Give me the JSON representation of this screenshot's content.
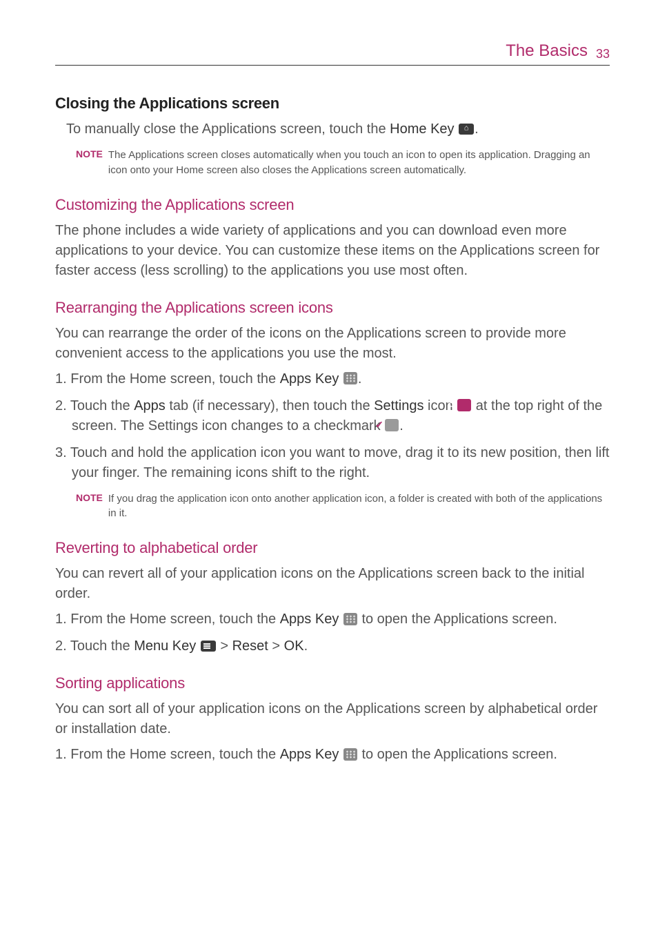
{
  "header": {
    "section": "The Basics",
    "page": "33"
  },
  "closing": {
    "heading": "Closing the Applications screen",
    "body_part1": "To manually close the Applications screen, touch the ",
    "body_bold": "Home Key",
    "body_part2": ".",
    "note_label": "NOTE",
    "note_text": "The Applications screen closes automatically when you touch an icon to open its application. Dragging an icon onto your Home screen also closes the Applications screen automatically."
  },
  "customizing": {
    "heading": "Customizing the Applications screen",
    "body": "The phone includes a wide variety of applications and you can download even more applications to your device. You can customize these items on the Applications screen for faster access (less scrolling) to the applications you use most often."
  },
  "rearranging": {
    "heading": "Rearranging the Applications screen icons",
    "body": "You can rearrange the order of the icons on the Applications screen to provide more convenient access to the applications you use the most.",
    "step1_a": "From the Home screen, touch the ",
    "step1_b": "Apps Key",
    "step1_c": ".",
    "step2_a": "Touch the ",
    "step2_b": "Apps",
    "step2_c": " tab (if necessary), then touch the ",
    "step2_d": "Settings",
    "step2_e": " icon ",
    "step2_f": " at the top right of the screen. The Settings icon changes to a checkmark ",
    "step2_g": ".",
    "step3": "Touch and hold the application icon you want to move, drag it to its new position, then lift your finger. The remaining icons shift to the right.",
    "note_label": "NOTE",
    "note_text": "If you drag the application icon onto another application icon, a folder is created with both of the applications in it."
  },
  "reverting": {
    "heading": "Reverting to alphabetical order",
    "body": "You can revert all of your application icons on the Applications screen back to the initial order.",
    "step1_a": "From the Home screen, touch the ",
    "step1_b": "Apps Key",
    "step1_c": " to open the Applications screen.",
    "step2_a": "Touch the ",
    "step2_b": "Menu Key",
    "step2_c": " > ",
    "step2_d": "Reset",
    "step2_e": " > ",
    "step2_f": "OK",
    "step2_g": "."
  },
  "sorting": {
    "heading": "Sorting applications",
    "body": "You can sort all of your application icons on the Applications screen by alphabetical order or installation date.",
    "step1_a": "From the Home screen, touch the ",
    "step1_b": "Apps Key",
    "step1_c": " to open the Applications screen."
  }
}
